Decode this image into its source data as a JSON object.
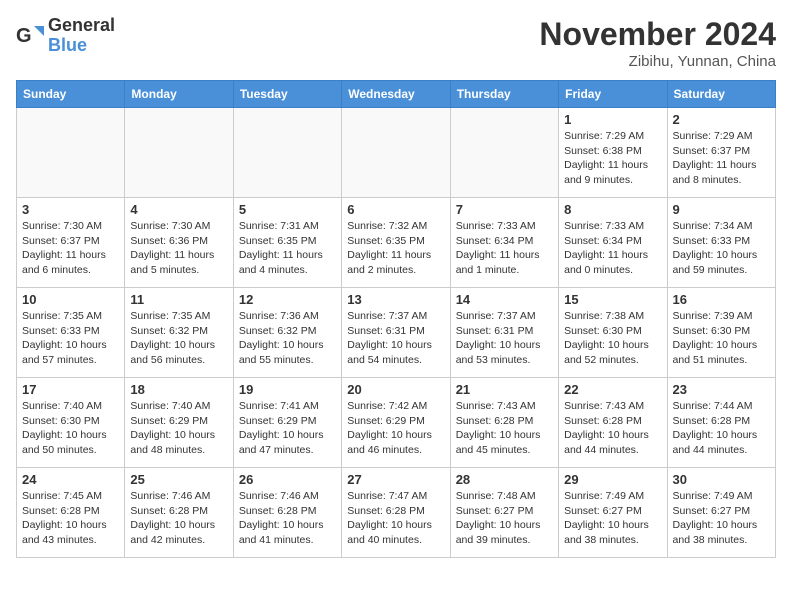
{
  "header": {
    "logo": {
      "general": "General",
      "blue": "Blue"
    },
    "title": "November 2024",
    "location": "Zibihu, Yunnan, China"
  },
  "weekdays": [
    "Sunday",
    "Monday",
    "Tuesday",
    "Wednesday",
    "Thursday",
    "Friday",
    "Saturday"
  ],
  "weeks": [
    [
      {
        "day": null,
        "info": null
      },
      {
        "day": null,
        "info": null
      },
      {
        "day": null,
        "info": null
      },
      {
        "day": null,
        "info": null
      },
      {
        "day": null,
        "info": null
      },
      {
        "day": "1",
        "info": "Sunrise: 7:29 AM\nSunset: 6:38 PM\nDaylight: 11 hours\nand 9 minutes."
      },
      {
        "day": "2",
        "info": "Sunrise: 7:29 AM\nSunset: 6:37 PM\nDaylight: 11 hours\nand 8 minutes."
      }
    ],
    [
      {
        "day": "3",
        "info": "Sunrise: 7:30 AM\nSunset: 6:37 PM\nDaylight: 11 hours\nand 6 minutes."
      },
      {
        "day": "4",
        "info": "Sunrise: 7:30 AM\nSunset: 6:36 PM\nDaylight: 11 hours\nand 5 minutes."
      },
      {
        "day": "5",
        "info": "Sunrise: 7:31 AM\nSunset: 6:35 PM\nDaylight: 11 hours\nand 4 minutes."
      },
      {
        "day": "6",
        "info": "Sunrise: 7:32 AM\nSunset: 6:35 PM\nDaylight: 11 hours\nand 2 minutes."
      },
      {
        "day": "7",
        "info": "Sunrise: 7:33 AM\nSunset: 6:34 PM\nDaylight: 11 hours\nand 1 minute."
      },
      {
        "day": "8",
        "info": "Sunrise: 7:33 AM\nSunset: 6:34 PM\nDaylight: 11 hours\nand 0 minutes."
      },
      {
        "day": "9",
        "info": "Sunrise: 7:34 AM\nSunset: 6:33 PM\nDaylight: 10 hours\nand 59 minutes."
      }
    ],
    [
      {
        "day": "10",
        "info": "Sunrise: 7:35 AM\nSunset: 6:33 PM\nDaylight: 10 hours\nand 57 minutes."
      },
      {
        "day": "11",
        "info": "Sunrise: 7:35 AM\nSunset: 6:32 PM\nDaylight: 10 hours\nand 56 minutes."
      },
      {
        "day": "12",
        "info": "Sunrise: 7:36 AM\nSunset: 6:32 PM\nDaylight: 10 hours\nand 55 minutes."
      },
      {
        "day": "13",
        "info": "Sunrise: 7:37 AM\nSunset: 6:31 PM\nDaylight: 10 hours\nand 54 minutes."
      },
      {
        "day": "14",
        "info": "Sunrise: 7:37 AM\nSunset: 6:31 PM\nDaylight: 10 hours\nand 53 minutes."
      },
      {
        "day": "15",
        "info": "Sunrise: 7:38 AM\nSunset: 6:30 PM\nDaylight: 10 hours\nand 52 minutes."
      },
      {
        "day": "16",
        "info": "Sunrise: 7:39 AM\nSunset: 6:30 PM\nDaylight: 10 hours\nand 51 minutes."
      }
    ],
    [
      {
        "day": "17",
        "info": "Sunrise: 7:40 AM\nSunset: 6:30 PM\nDaylight: 10 hours\nand 50 minutes."
      },
      {
        "day": "18",
        "info": "Sunrise: 7:40 AM\nSunset: 6:29 PM\nDaylight: 10 hours\nand 48 minutes."
      },
      {
        "day": "19",
        "info": "Sunrise: 7:41 AM\nSunset: 6:29 PM\nDaylight: 10 hours\nand 47 minutes."
      },
      {
        "day": "20",
        "info": "Sunrise: 7:42 AM\nSunset: 6:29 PM\nDaylight: 10 hours\nand 46 minutes."
      },
      {
        "day": "21",
        "info": "Sunrise: 7:43 AM\nSunset: 6:28 PM\nDaylight: 10 hours\nand 45 minutes."
      },
      {
        "day": "22",
        "info": "Sunrise: 7:43 AM\nSunset: 6:28 PM\nDaylight: 10 hours\nand 44 minutes."
      },
      {
        "day": "23",
        "info": "Sunrise: 7:44 AM\nSunset: 6:28 PM\nDaylight: 10 hours\nand 44 minutes."
      }
    ],
    [
      {
        "day": "24",
        "info": "Sunrise: 7:45 AM\nSunset: 6:28 PM\nDaylight: 10 hours\nand 43 minutes."
      },
      {
        "day": "25",
        "info": "Sunrise: 7:46 AM\nSunset: 6:28 PM\nDaylight: 10 hours\nand 42 minutes."
      },
      {
        "day": "26",
        "info": "Sunrise: 7:46 AM\nSunset: 6:28 PM\nDaylight: 10 hours\nand 41 minutes."
      },
      {
        "day": "27",
        "info": "Sunrise: 7:47 AM\nSunset: 6:28 PM\nDaylight: 10 hours\nand 40 minutes."
      },
      {
        "day": "28",
        "info": "Sunrise: 7:48 AM\nSunset: 6:27 PM\nDaylight: 10 hours\nand 39 minutes."
      },
      {
        "day": "29",
        "info": "Sunrise: 7:49 AM\nSunset: 6:27 PM\nDaylight: 10 hours\nand 38 minutes."
      },
      {
        "day": "30",
        "info": "Sunrise: 7:49 AM\nSunset: 6:27 PM\nDaylight: 10 hours\nand 38 minutes."
      }
    ]
  ]
}
